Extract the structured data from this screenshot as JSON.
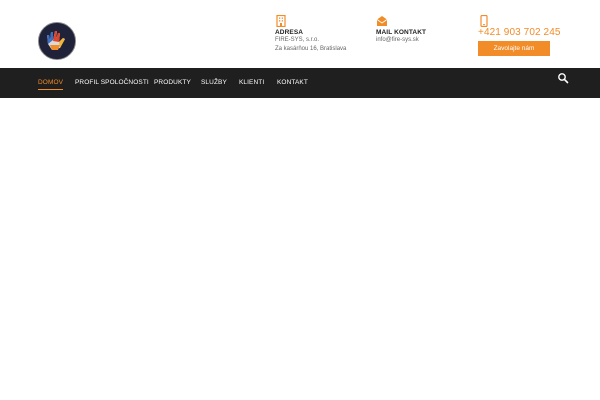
{
  "header": {
    "logo_icon": "hand-logo-icon",
    "address": {
      "icon": "building-icon",
      "title": "ADRESA",
      "line1": "FIRE-SYS, s.r.o.",
      "line2": "Za kasárňou 16, Bratislava"
    },
    "mail": {
      "icon": "envelope-icon",
      "title": "MAIL KONTAKT",
      "line1": "info@fire-sys.sk"
    },
    "phone": {
      "icon": "phone-icon",
      "number": "+421 903 702 245",
      "cta_label": "Zavolajte nám"
    }
  },
  "nav": {
    "items": [
      "DOMOV",
      "PROFIL SPOLOČNOSTI",
      "PRODUKTY",
      "SLUŽBY",
      "KLIENTI",
      "KONTAKT"
    ],
    "active_index": 0,
    "search_icon": "search-icon"
  },
  "colors": {
    "accent": "#f28c28",
    "nav_background": "#1f1f1f"
  }
}
